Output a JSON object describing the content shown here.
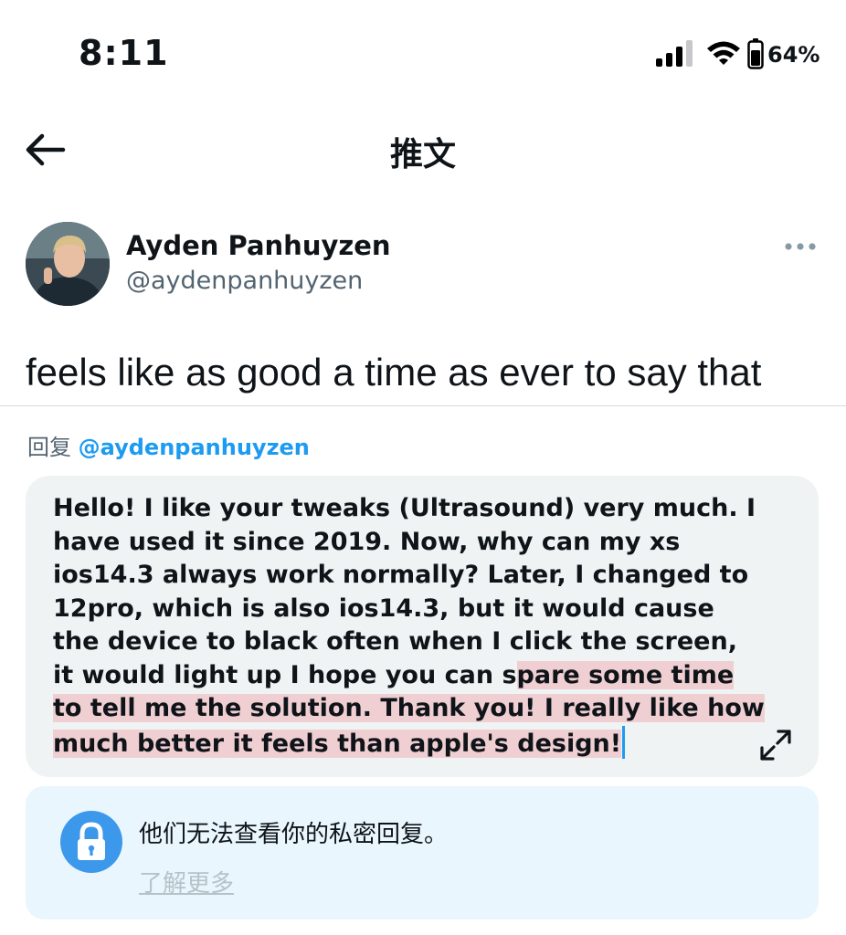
{
  "status_bar": {
    "time": "8:11",
    "battery_percent": "64%",
    "battery_level": 0.64
  },
  "nav": {
    "title": "推文",
    "back_icon": "arrow-left-icon"
  },
  "tweet": {
    "author_name": "Ayden Panhuyzen",
    "author_handle": "@aydenpanhuyzen",
    "text": "feels like as good a time as ever to say that",
    "more_icon": "ellipsis-icon"
  },
  "reply": {
    "prefix": "回复",
    "handle": "@aydenpanhuyzen",
    "text_unselected": "Hello! I like your tweaks (Ultrasound) very much. I have used it since 2019. Now, why can my xs ios14.3 always work normally? Later, I changed to 12pro, which is also ios14.3, but it would cause the device to black often when I click the screen, it would light up I hope you can s",
    "text_selected": "pare some time to tell me the solution. Thank you! I really like how much better it feels than apple's design!",
    "expand_icon": "expand-icon"
  },
  "privacy": {
    "message": "他们无法查看你的私密回复。",
    "learn_more": "了解更多",
    "icon": "lock-icon"
  },
  "colors": {
    "accent": "#1d9bf0",
    "selection": "#f0cfd3",
    "compose_bg": "#eff3f4",
    "privacy_bg": "#eaf6fe",
    "lock_circle": "#3c98eb"
  }
}
